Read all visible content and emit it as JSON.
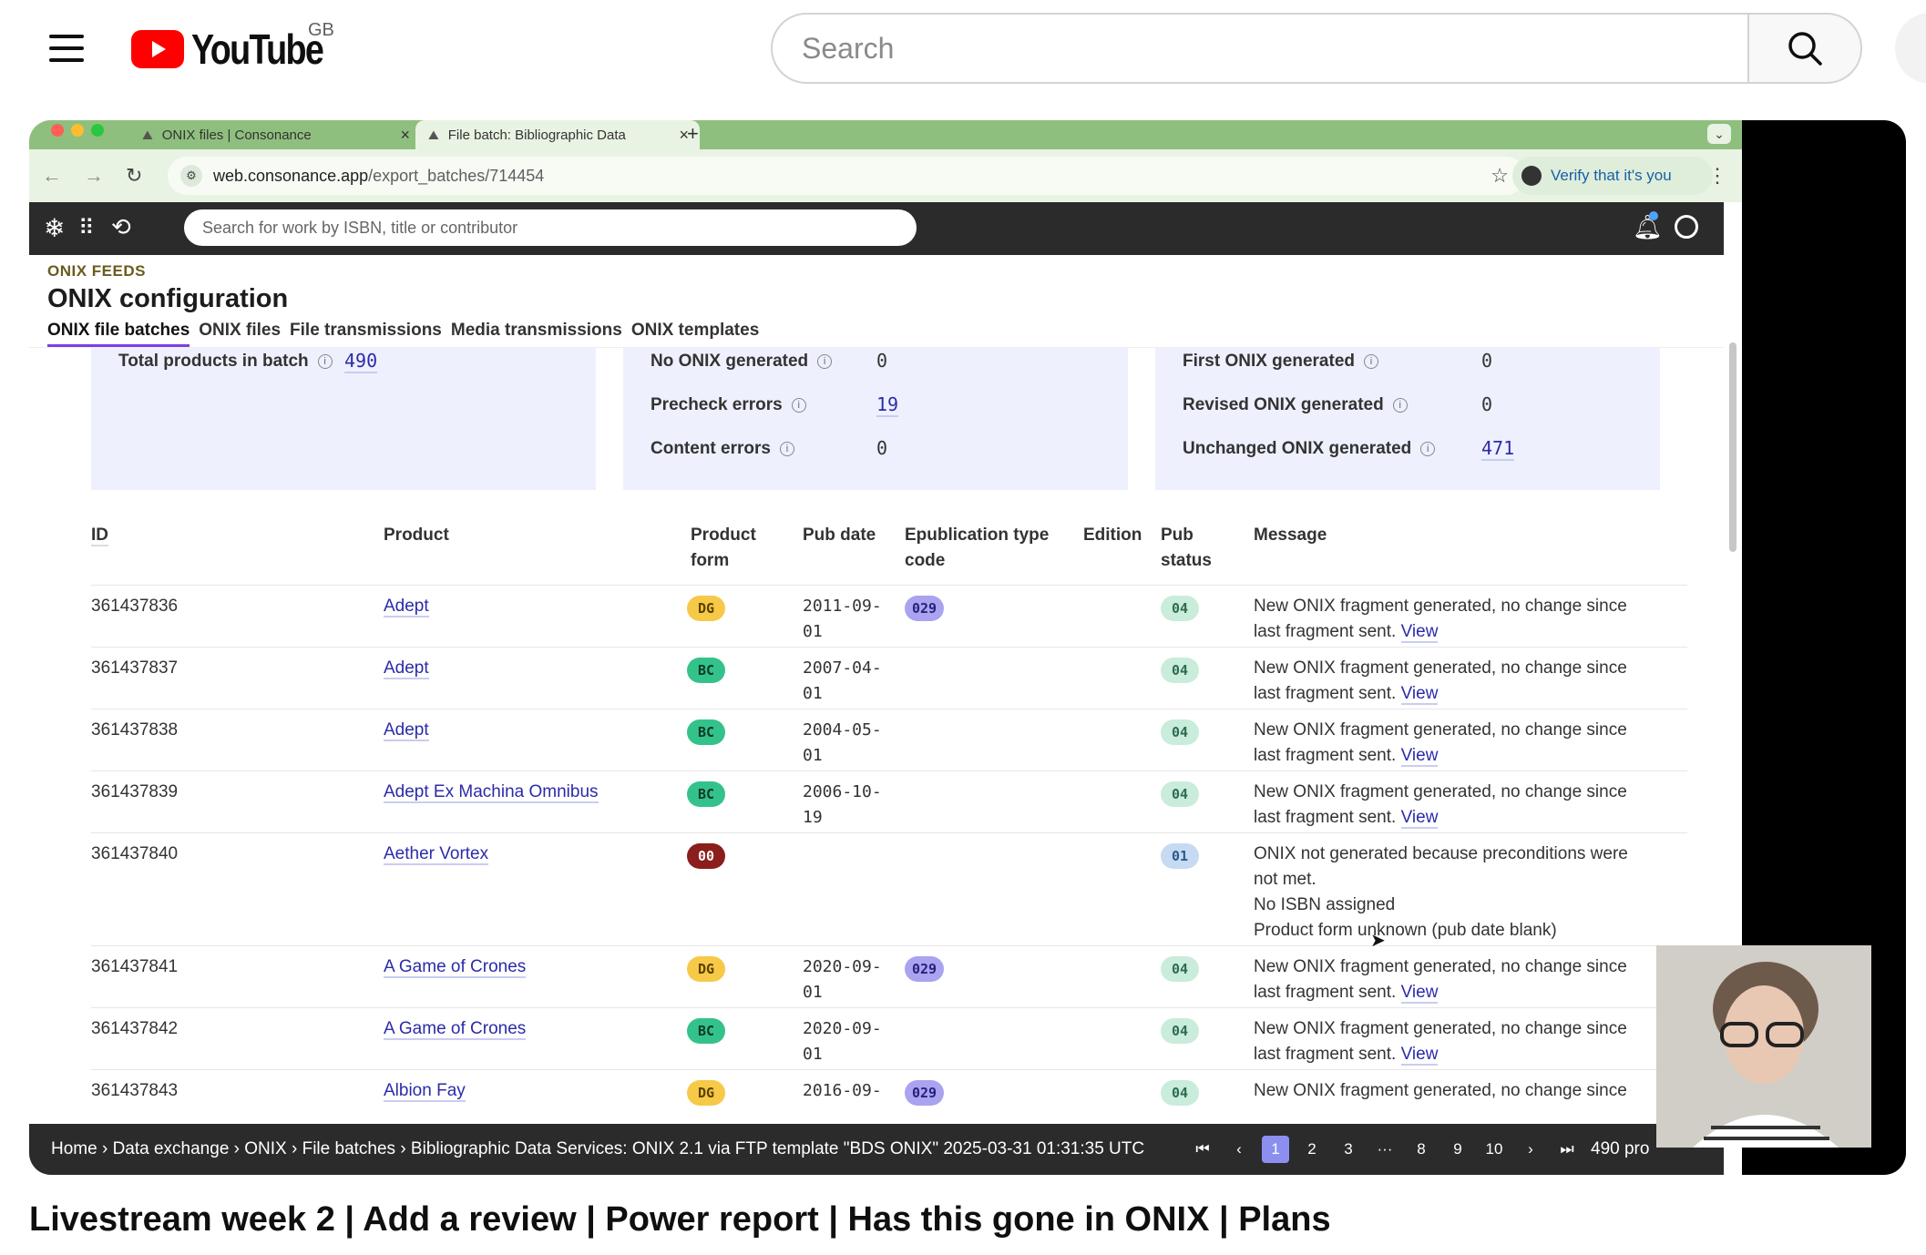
{
  "youtube": {
    "logo_text": "YouTube",
    "country": "GB",
    "search_placeholder": "Search",
    "video_title": "Livestream week 2 | Add a review | Power report | Has this gone in ONIX | Plans"
  },
  "browser": {
    "tabs": [
      {
        "label": "ONIX files | Consonance"
      },
      {
        "label": "File batch: Bibliographic Data"
      }
    ],
    "url_host": "web.consonance.app",
    "url_path": "/export_batches/714454",
    "verify_label": "Verify that it's you"
  },
  "app": {
    "search_placeholder": "Search for work by ISBN, title or contributor",
    "eyebrow": "ONIX FEEDS",
    "title": "ONIX configuration",
    "subtabs": [
      "ONIX file batches",
      "ONIX files",
      "File transmissions",
      "Media transmissions",
      "ONIX templates"
    ]
  },
  "stats": {
    "total_label": "Total products in batch",
    "total_value": "490",
    "no_onix_label": "No ONIX generated",
    "no_onix_value": "0",
    "precheck_label": "Precheck errors",
    "precheck_value": "19",
    "content_label": "Content errors",
    "content_value": "0",
    "first_label": "First ONIX generated",
    "first_value": "0",
    "revised_label": "Revised ONIX generated",
    "revised_value": "0",
    "unchanged_label": "Unchanged ONIX generated",
    "unchanged_value": "471"
  },
  "table": {
    "headers": {
      "id": "ID",
      "product": "Product",
      "product_form_1": "Product",
      "product_form_2": "form",
      "pub_date": "Pub date",
      "epub_1": "Epublication type",
      "epub_2": "code",
      "edition": "Edition",
      "pub_status_1": "Pub",
      "pub_status_2": "status",
      "message": "Message"
    },
    "view_label": "View",
    "rows": [
      {
        "id": "361437836",
        "product": "Adept",
        "form": "DG",
        "date_1": "2011-09-",
        "date_2": "01",
        "epub": "029",
        "status": "04",
        "msg_1": "New ONIX fragment generated, no change since",
        "msg_2": "last fragment sent."
      },
      {
        "id": "361437837",
        "product": "Adept",
        "form": "BC",
        "date_1": "2007-04-",
        "date_2": "01",
        "epub": "",
        "status": "04",
        "msg_1": "New ONIX fragment generated, no change since",
        "msg_2": "last fragment sent."
      },
      {
        "id": "361437838",
        "product": "Adept",
        "form": "BC",
        "date_1": "2004-05-",
        "date_2": "01",
        "epub": "",
        "status": "04",
        "msg_1": "New ONIX fragment generated, no change since",
        "msg_2": "last fragment sent."
      },
      {
        "id": "361437839",
        "product": "Adept Ex Machina Omnibus",
        "form": "BC",
        "date_1": "2006-10-",
        "date_2": "19",
        "epub": "",
        "status": "04",
        "msg_1": "New ONIX fragment generated, no change since",
        "msg_2": "last fragment sent."
      },
      {
        "id": "361437840",
        "product": "Aether Vortex",
        "form": "00",
        "date_1": "",
        "date_2": "",
        "epub": "",
        "status": "01",
        "msg_1": "ONIX not generated because preconditions were",
        "msg_2": "not met.",
        "msg_3": "No ISBN assigned",
        "msg_4": "Product form unknown (pub date blank)"
      },
      {
        "id": "361437841",
        "product": "A Game of Crones",
        "form": "DG",
        "date_1": "2020-09-",
        "date_2": "01",
        "epub": "029",
        "status": "04",
        "msg_1": "New ONIX fragment generated, no change since",
        "msg_2": "last fragment sent."
      },
      {
        "id": "361437842",
        "product": "A Game of Crones",
        "form": "BC",
        "date_1": "2020-09-",
        "date_2": "01",
        "epub": "",
        "status": "04",
        "msg_1": "New ONIX fragment generated, no change since",
        "msg_2": "last fragment sent."
      },
      {
        "id": "361437843",
        "product": "Albion Fay",
        "form": "DG",
        "date_1": "2016-09-",
        "date_2": "",
        "epub": "029",
        "status": "04",
        "msg_1": "New ONIX fragment generated, no change since",
        "msg_2": ""
      }
    ]
  },
  "footer": {
    "breadcrumb": "Home › Data exchange › ONIX › File batches › Bibliographic Data Services: ONIX 2.1 via FTP template \"BDS ONIX\" 2025-03-31 01:31:35 UTC",
    "pages": [
      "1",
      "2",
      "3",
      "···",
      "8",
      "9",
      "10"
    ],
    "count": "490 pro"
  }
}
